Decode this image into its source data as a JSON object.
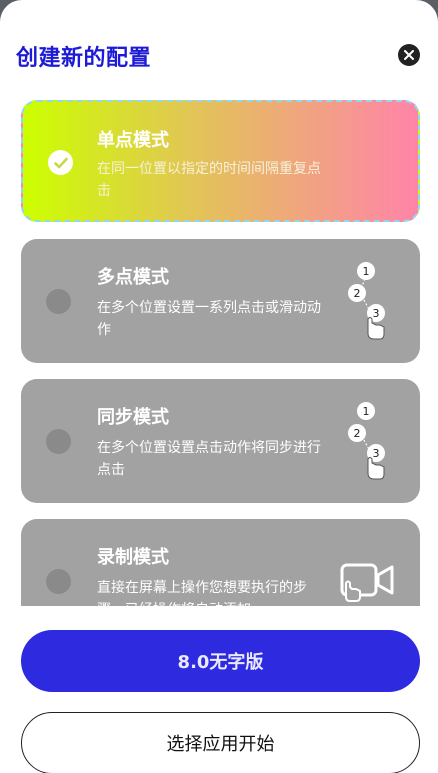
{
  "dialog": {
    "title": "创建新的配置"
  },
  "modes": [
    {
      "title": "单点模式",
      "description": "在同一位置以指定的时间间隔重复点击",
      "selected": true,
      "icon": "checkmark-icon"
    },
    {
      "title": "多点模式",
      "description": "在多个位置设置一系列点击或滑动动作",
      "selected": false,
      "icon": "multi-tap-icon",
      "steps": [
        "1",
        "2",
        "3"
      ]
    },
    {
      "title": "同步模式",
      "description": "在多个位置设置点击动作将同步进行点击",
      "selected": false,
      "icon": "sync-tap-icon",
      "steps": [
        "1",
        "2",
        "3"
      ]
    },
    {
      "title": "录制模式",
      "description": "直接在屏幕上操作您想要执行的步骤，已经操作将自动添加",
      "selected": false,
      "icon": "video-record-icon"
    }
  ],
  "buttons": {
    "primary_label": "8.0无字版",
    "secondary_label": "选择应用开始"
  },
  "colors": {
    "title": "#1d1bd6",
    "primary_button": "#2d2ae0",
    "card_inactive": "#a2a2a2",
    "gradient_start": "#ccff00",
    "gradient_end": "#ff84a8"
  }
}
